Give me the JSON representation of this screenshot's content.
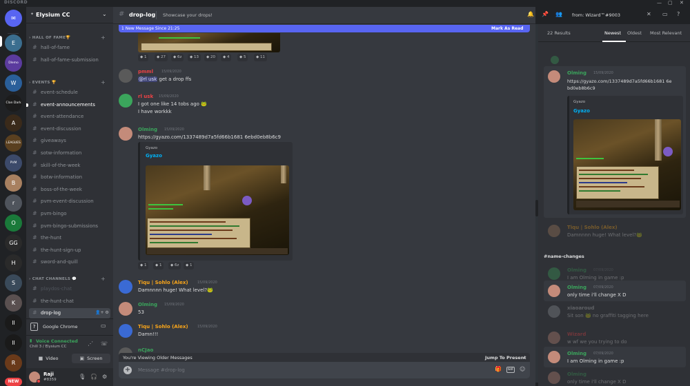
{
  "app": {
    "brand": "DISCORD"
  },
  "rail": {
    "servers": [
      {
        "short": "E",
        "color": "#3b6e8f"
      },
      {
        "short": "Dlemo",
        "color": "#5b3b9e"
      },
      {
        "short": "W",
        "color": "#2a5f9a"
      },
      {
        "short": "Clan Dark",
        "color": "#1c1c1c"
      },
      {
        "short": "A",
        "color": "#3a2a1a"
      },
      {
        "short": "LEAGUES",
        "color": "#5a4020"
      },
      {
        "short": "PVM BINGO",
        "color": "#3c4a6a"
      },
      {
        "short": "B",
        "color": "#a88060"
      },
      {
        "short": "r",
        "color": "#4f545c"
      },
      {
        "short": "O",
        "color": "#1a7a3a"
      },
      {
        "short": "GG",
        "color": "#2a2a2a"
      },
      {
        "short": "H",
        "color": "#2a2a2a"
      },
      {
        "short": "S",
        "color": "#3a4a5a"
      },
      {
        "short": "K",
        "color": "#5a5050"
      },
      {
        "short": "ll",
        "color": "#1a1a1a"
      },
      {
        "short": "ll",
        "color": "#1a1a1a"
      },
      {
        "short": "R",
        "color": "#6a3a1a"
      }
    ],
    "new_badge": "NEW"
  },
  "server": {
    "name": "Elysium CC",
    "categories": [
      {
        "label": "HALL OF FAME🏆",
        "channels": [
          "hall-of-fame",
          "hall-of-fame-submission"
        ]
      },
      {
        "label": "EVENTS 🏆",
        "channels": [
          "event-schedule",
          "event-announcements",
          "event-attendance",
          "event-discussion",
          "giveaways",
          "sotw-information",
          "skill-of-the-week",
          "botw-information",
          "boss-of-the-week",
          "pvm-event-discussion",
          "pvm-bingo",
          "pvm-bingo-submissions",
          "the-hunt",
          "the-hunt-sign-up",
          "sword-and-quill"
        ]
      },
      {
        "label": "CHAT CHANNELS 💬",
        "channels": [
          "playdos-chat",
          "the-hunt-chat",
          "drop-log"
        ]
      }
    ]
  },
  "activity": {
    "app": "Google Chrome"
  },
  "voice": {
    "status": "Voice Connected",
    "location": "Chill 3 / Elysium CC",
    "video_label": "Video",
    "screen_label": "Screen"
  },
  "user": {
    "name": "Raji",
    "tag": "#8359"
  },
  "chat": {
    "channel": "drop-log",
    "topic": "Showcase your drops!",
    "new_messages": "1 New Message Since 21:25",
    "mark_read": "Mark As Read",
    "top_reactions": [
      "1",
      "27",
      "6z",
      "13",
      "20",
      "4",
      "5",
      "11"
    ],
    "messages": [
      {
        "author": "pmml",
        "color": "#ed4245",
        "time": "15/09/2020",
        "lines": [
          "get a drop ffs"
        ],
        "mention": "@rl usk"
      },
      {
        "author": "rl usk",
        "color": "#ed4245",
        "time": "15/09/2020",
        "lines": [
          "I got one like 14 tobs ago 🐸",
          "I have workkk"
        ]
      },
      {
        "author": "Olming",
        "color": "#3ba55c",
        "time": "15/09/2020",
        "link": "https://gyazo.com/1337489d7a5fd66b1681 6ebd0eb8b6c9",
        "embed_provider": "Gyazo",
        "embed_title": "Gyazo",
        "reactions": [
          "1",
          "1",
          "6z",
          "1"
        ]
      },
      {
        "author": "Tiqu | Sohlo (Alex)",
        "color": "#faa61a",
        "time": "15/09/2020",
        "lines": [
          "Damnnnn huge! What level?🐸"
        ]
      },
      {
        "author": "Olming",
        "color": "#3ba55c",
        "time": "15/09/2020",
        "lines": [
          "53"
        ]
      },
      {
        "author": "Tiqu | Sohlo (Alex)",
        "color": "#faa61a",
        "time": "15/09/2020",
        "lines": [
          "Damn!!!"
        ]
      },
      {
        "author": "nCJao",
        "color": "#3ba55c",
        "time": "",
        "lines": []
      }
    ],
    "older_notice": "You're Viewing Older Messages",
    "jump_present": "Jump To Present",
    "composer_placeholder": "Message #drop-log"
  },
  "search": {
    "query": "from: Wizard™#9003",
    "results_count": "22 Results",
    "tabs": [
      "Newest",
      "Oldest",
      "Most Relevant"
    ],
    "active_tab": "Newest",
    "results": [
      {
        "author": "Olming",
        "color": "#3ba55c",
        "time": "15/09/2020",
        "lines": [
          "https://gyazo.com/1337489d7a5fd66b1681 6e",
          "bd0eb8b6c9"
        ],
        "provider": "Gyazo",
        "title": "Gyazo"
      },
      {
        "author": "Tiqu | Sohlo (Alex)",
        "color": "#faa61a",
        "time": "",
        "lines": [
          "Damnnnn huge! What level?🐸"
        ]
      }
    ],
    "section": "#name-changes",
    "section_results": [
      {
        "author": "Olming",
        "color": "#3ba55c",
        "time": "07/09/2020",
        "lines": [
          "I am Olming in game :p"
        ],
        "faded": true
      },
      {
        "author": "Olming",
        "color": "#3ba55c",
        "time": "07/09/2020",
        "lines": [
          "only time i'll change X D"
        ],
        "faded": false
      },
      {
        "author": "xiaoaroud",
        "color": "#b9bbbe",
        "time": "",
        "lines": [
          "Sit son 🐸 no graffiti tagging here"
        ],
        "faded": true
      },
      {
        "author": "Wizard",
        "color": "#ed4245",
        "time": "",
        "lines": [
          "w wf we you trying to do"
        ],
        "faded": true
      },
      {
        "author": "Olming",
        "color": "#3ba55c",
        "time": "07/09/2020",
        "lines": [
          "I am Olming in game :p"
        ],
        "faded": false
      },
      {
        "author": "Olming",
        "color": "#3ba55c",
        "time": "",
        "lines": [
          "only time i'll change X D"
        ],
        "faded": true
      }
    ]
  }
}
